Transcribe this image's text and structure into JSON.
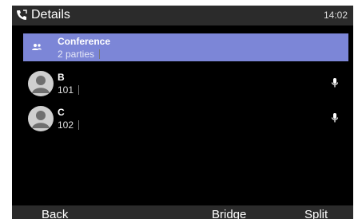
{
  "header": {
    "title": "Details",
    "time": "14:02",
    "icon": "call-details-icon"
  },
  "calls": [
    {
      "name": "Conference",
      "sub": "2 parties",
      "icon": "conference-icon",
      "selected": true
    },
    {
      "name": "B",
      "sub": "101",
      "icon": "mic-icon"
    },
    {
      "name": "C",
      "sub": "102",
      "icon": "mic-icon"
    }
  ],
  "softkeys": {
    "back": "Back",
    "bridge": "Bridge",
    "split": "Split"
  },
  "colors": {
    "selected": "#7c86d7",
    "background": "#000000",
    "bar": "#2b2b2b"
  }
}
